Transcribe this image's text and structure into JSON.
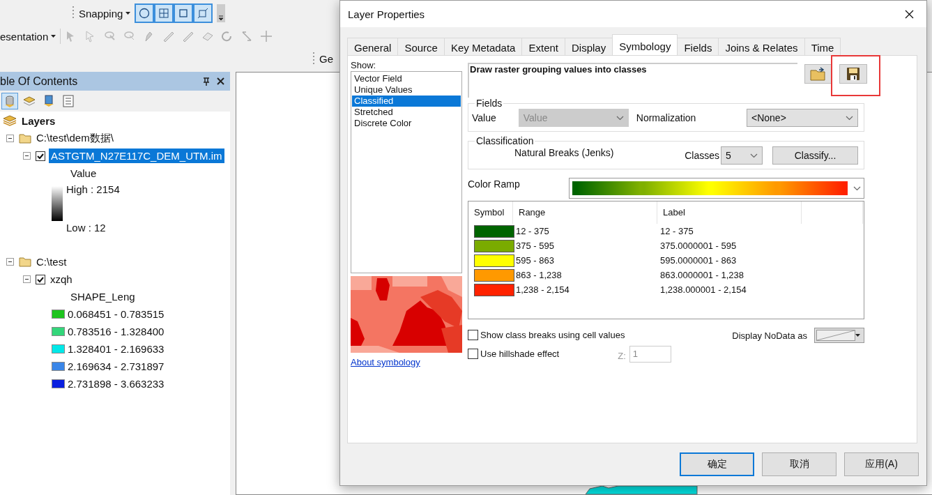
{
  "toolbars": {
    "snapping": "Snapping",
    "row2_label": "esentation",
    "row3_label": "Ge"
  },
  "toc": {
    "title": "ble Of Contents",
    "root": "Layers",
    "groups": [
      {
        "path": "C:\\test\\dem数据\\",
        "expanded": true,
        "layers": [
          {
            "kind": "stretch",
            "name": "ASTGTM_N27E117C_DEM_UTM.im",
            "expanded": true,
            "checked": true,
            "selected": true,
            "field": "Value",
            "high": "High : 2154",
            "low": "Low : 12"
          }
        ]
      },
      {
        "path": "C:\\test",
        "expanded": true,
        "layers": [
          {
            "kind": "classes",
            "name": "xzqh",
            "expanded": true,
            "checked": true,
            "selected": false,
            "field": "SHAPE_Leng",
            "classes": [
              {
                "label": "0.068451 - 0.783515",
                "color": "#1ec41e"
              },
              {
                "label": "0.783516 - 1.328400",
                "color": "#33d67a"
              },
              {
                "label": "1.328401 - 2.169633",
                "color": "#00e8e8"
              },
              {
                "label": "2.169634 - 2.731897",
                "color": "#3a86e8"
              },
              {
                "label": "2.731898 - 3.663233",
                "color": "#0a20e0"
              }
            ]
          }
        ]
      }
    ]
  },
  "dialog": {
    "title": "Layer Properties",
    "tabs": [
      {
        "label": "General",
        "selected": false
      },
      {
        "label": "Source",
        "selected": false
      },
      {
        "label": "Key Metadata",
        "selected": false
      },
      {
        "label": "Extent",
        "selected": false
      },
      {
        "label": "Display",
        "selected": false
      },
      {
        "label": "Symbology",
        "selected": true
      },
      {
        "label": "Fields",
        "selected": false
      },
      {
        "label": "Joins & Relates",
        "selected": false
      },
      {
        "label": "Time",
        "selected": false
      }
    ],
    "show_label": "Show:",
    "show_list": [
      {
        "label": "Vector Field",
        "selected": false
      },
      {
        "label": "Unique Values",
        "selected": false
      },
      {
        "label": "Classified",
        "selected": true
      },
      {
        "label": "Stretched",
        "selected": false
      },
      {
        "label": "Discrete Color",
        "selected": false
      }
    ],
    "about_link": "About symbology",
    "description": "Draw raster grouping values into classes",
    "save_highlighted": true,
    "fields": {
      "legend": "Fields",
      "value_label": "Value",
      "value": "Value",
      "value_disabled": true,
      "normalization_label": "Normalization",
      "normalization": "<None>"
    },
    "classification": {
      "legend": "Classification",
      "method": "Natural Breaks (Jenks)",
      "classes_label": "Classes",
      "classes": "5",
      "button": "Classify..."
    },
    "color_ramp": {
      "label": "Color Ramp",
      "stops": [
        {
          "color": "#006400"
        },
        {
          "color": "#7fb000"
        },
        {
          "color": "#ffff00"
        },
        {
          "color": "#ff9900"
        },
        {
          "color": "#ff2200"
        }
      ]
    },
    "table": {
      "columns": [
        "Symbol",
        "Range",
        "Label"
      ],
      "rows": [
        {
          "color": "#006400",
          "range": "12 - 375",
          "label": "12 - 375"
        },
        {
          "color": "#7aab00",
          "range": "375 - 595",
          "label": "375.0000001 - 595"
        },
        {
          "color": "#ffff00",
          "range": "595 - 863",
          "label": "595.0000001 - 863"
        },
        {
          "color": "#ff9900",
          "range": "863 - 1,238",
          "label": "863.0000001 - 1,238"
        },
        {
          "color": "#ff2200",
          "range": "1,238 - 2,154",
          "label": "1,238.000001 - 2,154"
        }
      ]
    },
    "options": [
      {
        "label": "Show class breaks using cell values",
        "checked": false
      },
      {
        "label": "Use hillshade effect",
        "checked": false
      }
    ],
    "z_label": "Z:",
    "z_value": "1",
    "z_disabled": true,
    "nodata_label": "Display NoData as",
    "buttons": [
      {
        "label": "确定",
        "default": true
      },
      {
        "label": "取消",
        "default": false
      },
      {
        "label": "应用(A)",
        "default": false
      }
    ]
  }
}
